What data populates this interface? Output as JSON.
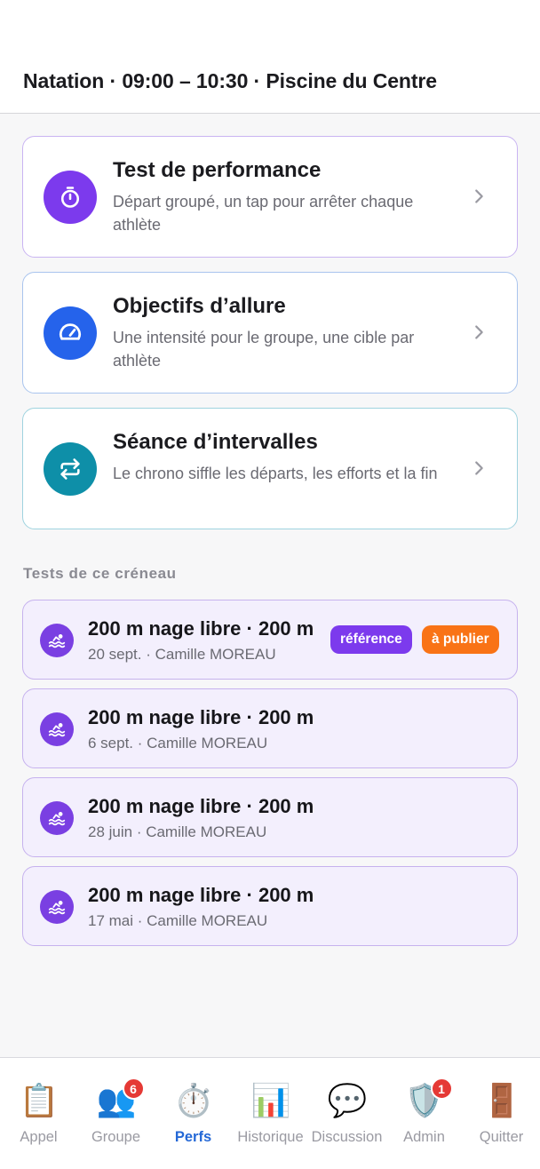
{
  "header": {
    "title": "Natation · 09:00 – 10:30 · Piscine du Centre"
  },
  "modes": [
    {
      "title": "Test de performance",
      "description": "Départ groupé, un tap pour arrêter chaque athlète",
      "icon": "stopwatch-icon",
      "color": "#7c3aed"
    },
    {
      "title": "Objectifs d’allure",
      "description": "Une intensité pour le groupe, une cible par athlète",
      "icon": "speedometer-icon",
      "color": "#2563eb"
    },
    {
      "title": "Séance d’intervalles",
      "description": "Le chrono siffle les départs, les efforts et la fin",
      "icon": "repeat-icon",
      "color": "#0e8fa8"
    }
  ],
  "section": {
    "label": "Tests de ce créneau"
  },
  "tests": [
    {
      "title": "200 m nage libre · 200 m",
      "meta": "20 sept. · Camille MOREAU",
      "badges": [
        "référence",
        "à publier"
      ]
    },
    {
      "title": "200 m nage libre · 200 m",
      "meta": "6 sept. · Camille MOREAU"
    },
    {
      "title": "200 m nage libre · 200 m",
      "meta": "28 juin · Camille MOREAU"
    },
    {
      "title": "200 m nage libre · 200 m",
      "meta": "17 mai · Camille MOREAU"
    }
  ],
  "badge_colors": {
    "reference": "#7c3aed",
    "publish": "#f97316"
  },
  "nav": [
    {
      "label": "Appel",
      "icon": "clipboard-icon",
      "glyph": "📋"
    },
    {
      "label": "Groupe",
      "icon": "people-icon",
      "glyph": "👥",
      "badge": "6"
    },
    {
      "label": "Perfs",
      "icon": "stopwatch-icon",
      "glyph": "⏱️",
      "active": true
    },
    {
      "label": "Historique",
      "icon": "bar-chart-icon",
      "glyph": "📊"
    },
    {
      "label": "Discussion",
      "icon": "speech-bubble-icon",
      "glyph": "💬"
    },
    {
      "label": "Admin",
      "icon": "shield-icon",
      "glyph": "🛡️",
      "badge": "1"
    },
    {
      "label": "Quitter",
      "icon": "door-icon",
      "glyph": "🚪"
    }
  ]
}
